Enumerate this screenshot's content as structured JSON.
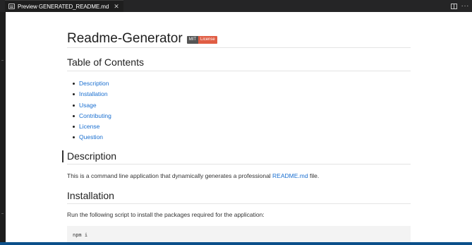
{
  "tab": {
    "title": "Preview GENERATED_README.md",
    "close_glyph": "✕",
    "more_glyph": "···"
  },
  "doc": {
    "title": "Readme-Generator",
    "badge": {
      "label": "MIT",
      "message": "License",
      "label_color": "#555555",
      "message_color": "#e05d44"
    },
    "toc_heading": "Table of Contents",
    "toc_items": [
      "Description",
      "Installation",
      "Usage",
      "Contributing",
      "License",
      "Question"
    ],
    "description": {
      "heading": "Description",
      "text_before": "This is a command line application that dynamically generates a professional ",
      "link": "README.md",
      "text_after": " file."
    },
    "installation": {
      "heading": "Installation",
      "text": "Run the following script to install the packages required for the application:",
      "code": "npm i"
    }
  },
  "colors": {
    "link": "#1a6fd0",
    "tab_bar": "#252526",
    "status_bar": "#0b4f8a"
  }
}
